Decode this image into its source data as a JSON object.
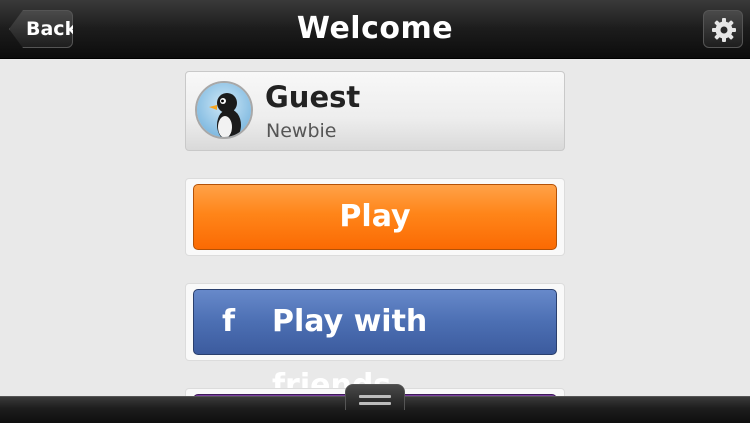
{
  "header": {
    "title": "Welcome",
    "back_label": "Back",
    "settings_icon": "gear-icon"
  },
  "profile": {
    "name": "Guest",
    "rank": "Newbie",
    "avatar_icon": "penguin-avatar-icon"
  },
  "buttons": {
    "play_label": "Play",
    "friends_label": "Play with friends",
    "friends_icon": "facebook-icon",
    "friends_icon_glyph": "f"
  },
  "bottom_bar": {
    "handle_icon": "drawer-handle-icon"
  },
  "colors": {
    "play": "#ff8519",
    "facebook": "#4c6fb3",
    "third_button": "#6b3190"
  }
}
